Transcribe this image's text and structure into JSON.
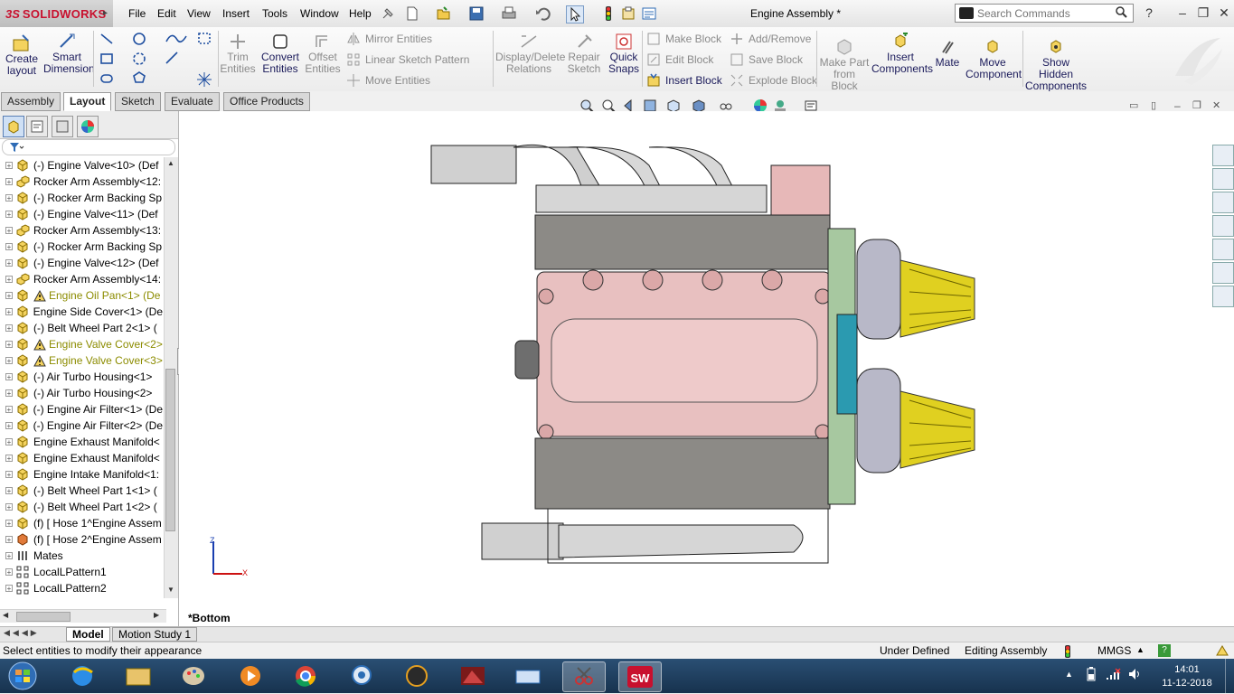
{
  "app": {
    "brand": "SOLIDWORKS",
    "brand_prefix": "3S",
    "title": "Engine Assembly *",
    "menus": [
      "File",
      "Edit",
      "View",
      "Insert",
      "Tools",
      "Window",
      "Help"
    ]
  },
  "search": {
    "placeholder": "Search Commands"
  },
  "ribbon": {
    "create_layout": "Create layout",
    "smart_dimension": "Smart Dimension",
    "trim_entities": "Trim Entities",
    "convert_entities": "Convert Entities",
    "offset_entities": "Offset Entities",
    "mirror_entities": "Mirror Entities",
    "linear_sketch_pattern": "Linear Sketch Pattern",
    "move_entities": "Move Entities",
    "display_delete_relations": "Display/Delete Relations",
    "repair_sketch": "Repair Sketch",
    "quick_snaps": "Quick Snaps",
    "make_block": "Make Block",
    "edit_block": "Edit Block",
    "insert_block": "Insert Block",
    "add_remove": "Add/Remove",
    "save_block": "Save Block",
    "explode_block": "Explode Block",
    "make_part_from_block": "Make Part from Block",
    "insert_components": "Insert Components",
    "mate": "Mate",
    "move_component": "Move Component",
    "show_hidden_components": "Show Hidden Components"
  },
  "tabs": [
    "Assembly",
    "Layout",
    "Sketch",
    "Evaluate",
    "Office Products"
  ],
  "active_tab": "Layout",
  "tree": [
    {
      "label": "(-) Engine Valve<10> (Def",
      "icon": "part-icon",
      "warn": false
    },
    {
      "label": "Rocker Arm Assembly<12:",
      "icon": "subassembly-icon",
      "warn": false
    },
    {
      "label": "(-) Rocker Arm Backing Sp",
      "icon": "part-icon",
      "warn": false
    },
    {
      "label": "(-) Engine Valve<11> (Def",
      "icon": "part-icon",
      "warn": false
    },
    {
      "label": "Rocker Arm Assembly<13:",
      "icon": "subassembly-icon",
      "warn": false
    },
    {
      "label": "(-) Rocker Arm Backing Sp",
      "icon": "part-icon",
      "warn": false
    },
    {
      "label": "(-) Engine Valve<12> (Def",
      "icon": "part-icon",
      "warn": false
    },
    {
      "label": "Rocker Arm Assembly<14:",
      "icon": "subassembly-icon",
      "warn": false
    },
    {
      "label": "Engine Oil Pan<1> (De",
      "icon": "part-icon",
      "warn": true
    },
    {
      "label": "Engine Side Cover<1> (De",
      "icon": "part-icon",
      "warn": false
    },
    {
      "label": "(-) Belt Wheel Part 2<1> (",
      "icon": "part-icon",
      "warn": false
    },
    {
      "label": "Engine Valve Cover<2>",
      "icon": "part-icon",
      "warn": true
    },
    {
      "label": "Engine Valve Cover<3>",
      "icon": "part-icon",
      "warn": true
    },
    {
      "label": "(-) Air Turbo Housing<1>",
      "icon": "part-icon",
      "warn": false
    },
    {
      "label": "(-) Air Turbo Housing<2>",
      "icon": "part-icon",
      "warn": false
    },
    {
      "label": "(-) Engine Air Filter<1> (De",
      "icon": "part-icon",
      "warn": false
    },
    {
      "label": "(-) Engine Air Filter<2> (De",
      "icon": "part-icon",
      "warn": false
    },
    {
      "label": "Engine Exhaust Manifold<",
      "icon": "part-icon",
      "warn": false
    },
    {
      "label": "Engine Exhaust Manifold<",
      "icon": "part-icon",
      "warn": false
    },
    {
      "label": "Engine Intake Manifold<1:",
      "icon": "part-icon",
      "warn": false
    },
    {
      "label": "(-) Belt Wheel Part 1<1> (",
      "icon": "part-icon",
      "warn": false
    },
    {
      "label": "(-) Belt Wheel Part 1<2> (",
      "icon": "part-icon",
      "warn": false
    },
    {
      "label": "(f) [ Hose 1^Engine Assem",
      "icon": "part-icon",
      "warn": false
    },
    {
      "label": "(f) [ Hose 2^Engine Assem",
      "icon": "virtual-part-icon",
      "warn": false
    },
    {
      "label": "Mates",
      "icon": "mates-icon",
      "warn": false
    },
    {
      "label": "LocalLPattern1",
      "icon": "pattern-icon",
      "warn": false
    },
    {
      "label": "LocalLPattern2",
      "icon": "pattern-icon",
      "warn": false
    }
  ],
  "viewport": {
    "view_label": "*Bottom",
    "axis_z": "Z",
    "axis_x": "X"
  },
  "bottom_tabs": [
    "Model",
    "Motion Study 1"
  ],
  "status": {
    "message": "Select entities to modify their appearance",
    "definition": "Under Defined",
    "mode": "Editing Assembly",
    "units": "MMGS",
    "units_arrow": "▲"
  },
  "taskbar": {
    "time": "14:01",
    "date": "11-12-2018"
  },
  "colors": {
    "brand_red": "#c8102e",
    "engine_block": "#e8c0c0",
    "air_filter": "#e0d020",
    "accent": "#1a5fb4"
  }
}
